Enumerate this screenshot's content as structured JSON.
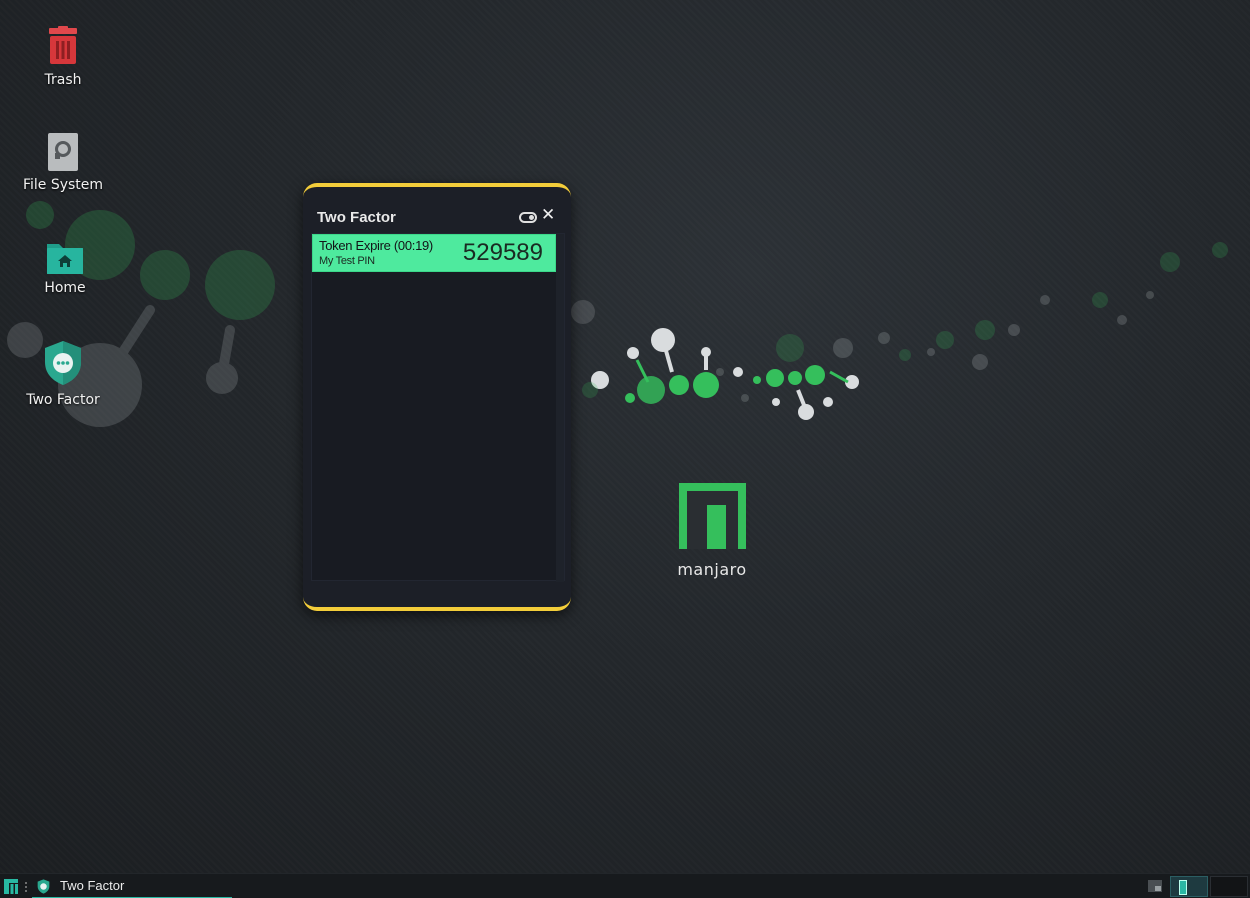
{
  "desktop": {
    "icons": [
      {
        "label": "Trash"
      },
      {
        "label": "File System"
      },
      {
        "label": "Home"
      },
      {
        "label": "Two Factor"
      }
    ],
    "brand": {
      "text": "manjaro",
      "color": "#35bf5c"
    }
  },
  "window": {
    "title": "Two Factor",
    "border_color": "#f3cd3a",
    "tokens": [
      {
        "title": "Token Expire (00:19)",
        "name": "My Test PIN",
        "code": "529589",
        "color": "#4eea9e"
      }
    ]
  },
  "taskbar": {
    "task_label": "Two Factor",
    "accent": "#28b9a3"
  }
}
